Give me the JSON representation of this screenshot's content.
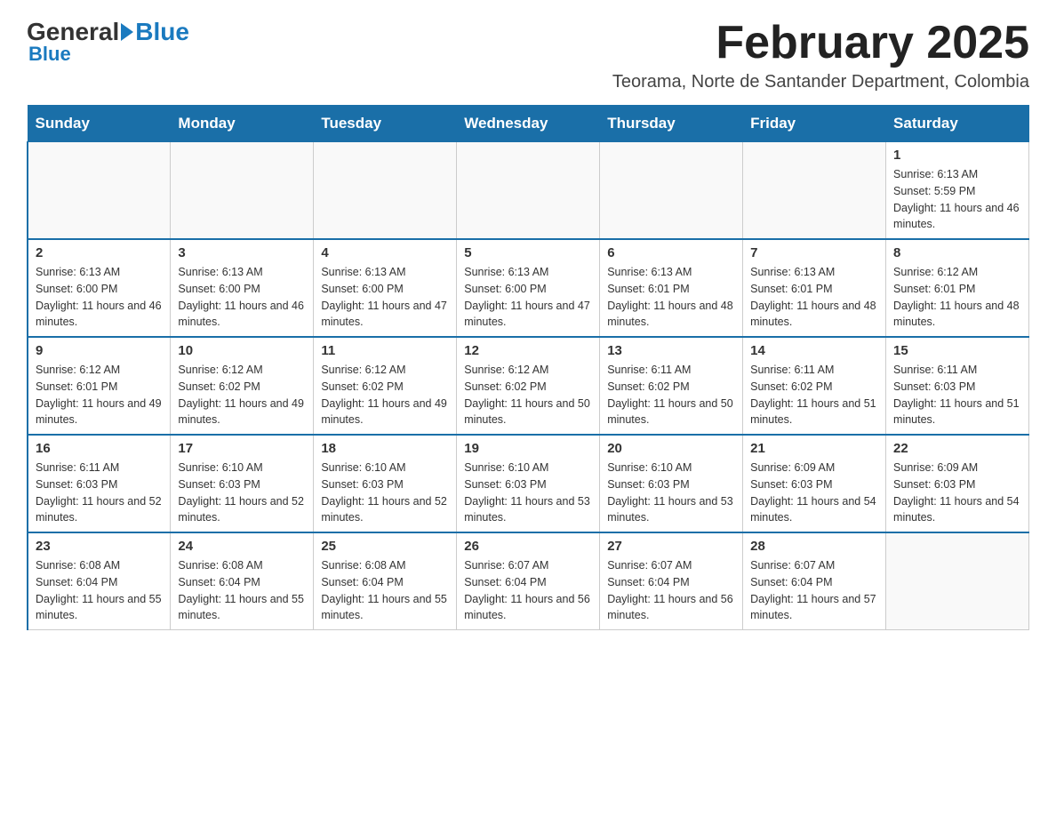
{
  "header": {
    "logo_general": "General",
    "logo_blue": "Blue",
    "month_title": "February 2025",
    "location": "Teorama, Norte de Santander Department, Colombia"
  },
  "days_of_week": [
    "Sunday",
    "Monday",
    "Tuesday",
    "Wednesday",
    "Thursday",
    "Friday",
    "Saturday"
  ],
  "weeks": [
    {
      "days": [
        {
          "num": "",
          "info": ""
        },
        {
          "num": "",
          "info": ""
        },
        {
          "num": "",
          "info": ""
        },
        {
          "num": "",
          "info": ""
        },
        {
          "num": "",
          "info": ""
        },
        {
          "num": "",
          "info": ""
        },
        {
          "num": "1",
          "info": "Sunrise: 6:13 AM\nSunset: 5:59 PM\nDaylight: 11 hours and 46 minutes."
        }
      ]
    },
    {
      "days": [
        {
          "num": "2",
          "info": "Sunrise: 6:13 AM\nSunset: 6:00 PM\nDaylight: 11 hours and 46 minutes."
        },
        {
          "num": "3",
          "info": "Sunrise: 6:13 AM\nSunset: 6:00 PM\nDaylight: 11 hours and 46 minutes."
        },
        {
          "num": "4",
          "info": "Sunrise: 6:13 AM\nSunset: 6:00 PM\nDaylight: 11 hours and 47 minutes."
        },
        {
          "num": "5",
          "info": "Sunrise: 6:13 AM\nSunset: 6:00 PM\nDaylight: 11 hours and 47 minutes."
        },
        {
          "num": "6",
          "info": "Sunrise: 6:13 AM\nSunset: 6:01 PM\nDaylight: 11 hours and 48 minutes."
        },
        {
          "num": "7",
          "info": "Sunrise: 6:13 AM\nSunset: 6:01 PM\nDaylight: 11 hours and 48 minutes."
        },
        {
          "num": "8",
          "info": "Sunrise: 6:12 AM\nSunset: 6:01 PM\nDaylight: 11 hours and 48 minutes."
        }
      ]
    },
    {
      "days": [
        {
          "num": "9",
          "info": "Sunrise: 6:12 AM\nSunset: 6:01 PM\nDaylight: 11 hours and 49 minutes."
        },
        {
          "num": "10",
          "info": "Sunrise: 6:12 AM\nSunset: 6:02 PM\nDaylight: 11 hours and 49 minutes."
        },
        {
          "num": "11",
          "info": "Sunrise: 6:12 AM\nSunset: 6:02 PM\nDaylight: 11 hours and 49 minutes."
        },
        {
          "num": "12",
          "info": "Sunrise: 6:12 AM\nSunset: 6:02 PM\nDaylight: 11 hours and 50 minutes."
        },
        {
          "num": "13",
          "info": "Sunrise: 6:11 AM\nSunset: 6:02 PM\nDaylight: 11 hours and 50 minutes."
        },
        {
          "num": "14",
          "info": "Sunrise: 6:11 AM\nSunset: 6:02 PM\nDaylight: 11 hours and 51 minutes."
        },
        {
          "num": "15",
          "info": "Sunrise: 6:11 AM\nSunset: 6:03 PM\nDaylight: 11 hours and 51 minutes."
        }
      ]
    },
    {
      "days": [
        {
          "num": "16",
          "info": "Sunrise: 6:11 AM\nSunset: 6:03 PM\nDaylight: 11 hours and 52 minutes."
        },
        {
          "num": "17",
          "info": "Sunrise: 6:10 AM\nSunset: 6:03 PM\nDaylight: 11 hours and 52 minutes."
        },
        {
          "num": "18",
          "info": "Sunrise: 6:10 AM\nSunset: 6:03 PM\nDaylight: 11 hours and 52 minutes."
        },
        {
          "num": "19",
          "info": "Sunrise: 6:10 AM\nSunset: 6:03 PM\nDaylight: 11 hours and 53 minutes."
        },
        {
          "num": "20",
          "info": "Sunrise: 6:10 AM\nSunset: 6:03 PM\nDaylight: 11 hours and 53 minutes."
        },
        {
          "num": "21",
          "info": "Sunrise: 6:09 AM\nSunset: 6:03 PM\nDaylight: 11 hours and 54 minutes."
        },
        {
          "num": "22",
          "info": "Sunrise: 6:09 AM\nSunset: 6:03 PM\nDaylight: 11 hours and 54 minutes."
        }
      ]
    },
    {
      "days": [
        {
          "num": "23",
          "info": "Sunrise: 6:08 AM\nSunset: 6:04 PM\nDaylight: 11 hours and 55 minutes."
        },
        {
          "num": "24",
          "info": "Sunrise: 6:08 AM\nSunset: 6:04 PM\nDaylight: 11 hours and 55 minutes."
        },
        {
          "num": "25",
          "info": "Sunrise: 6:08 AM\nSunset: 6:04 PM\nDaylight: 11 hours and 55 minutes."
        },
        {
          "num": "26",
          "info": "Sunrise: 6:07 AM\nSunset: 6:04 PM\nDaylight: 11 hours and 56 minutes."
        },
        {
          "num": "27",
          "info": "Sunrise: 6:07 AM\nSunset: 6:04 PM\nDaylight: 11 hours and 56 minutes."
        },
        {
          "num": "28",
          "info": "Sunrise: 6:07 AM\nSunset: 6:04 PM\nDaylight: 11 hours and 57 minutes."
        },
        {
          "num": "",
          "info": ""
        }
      ]
    }
  ]
}
